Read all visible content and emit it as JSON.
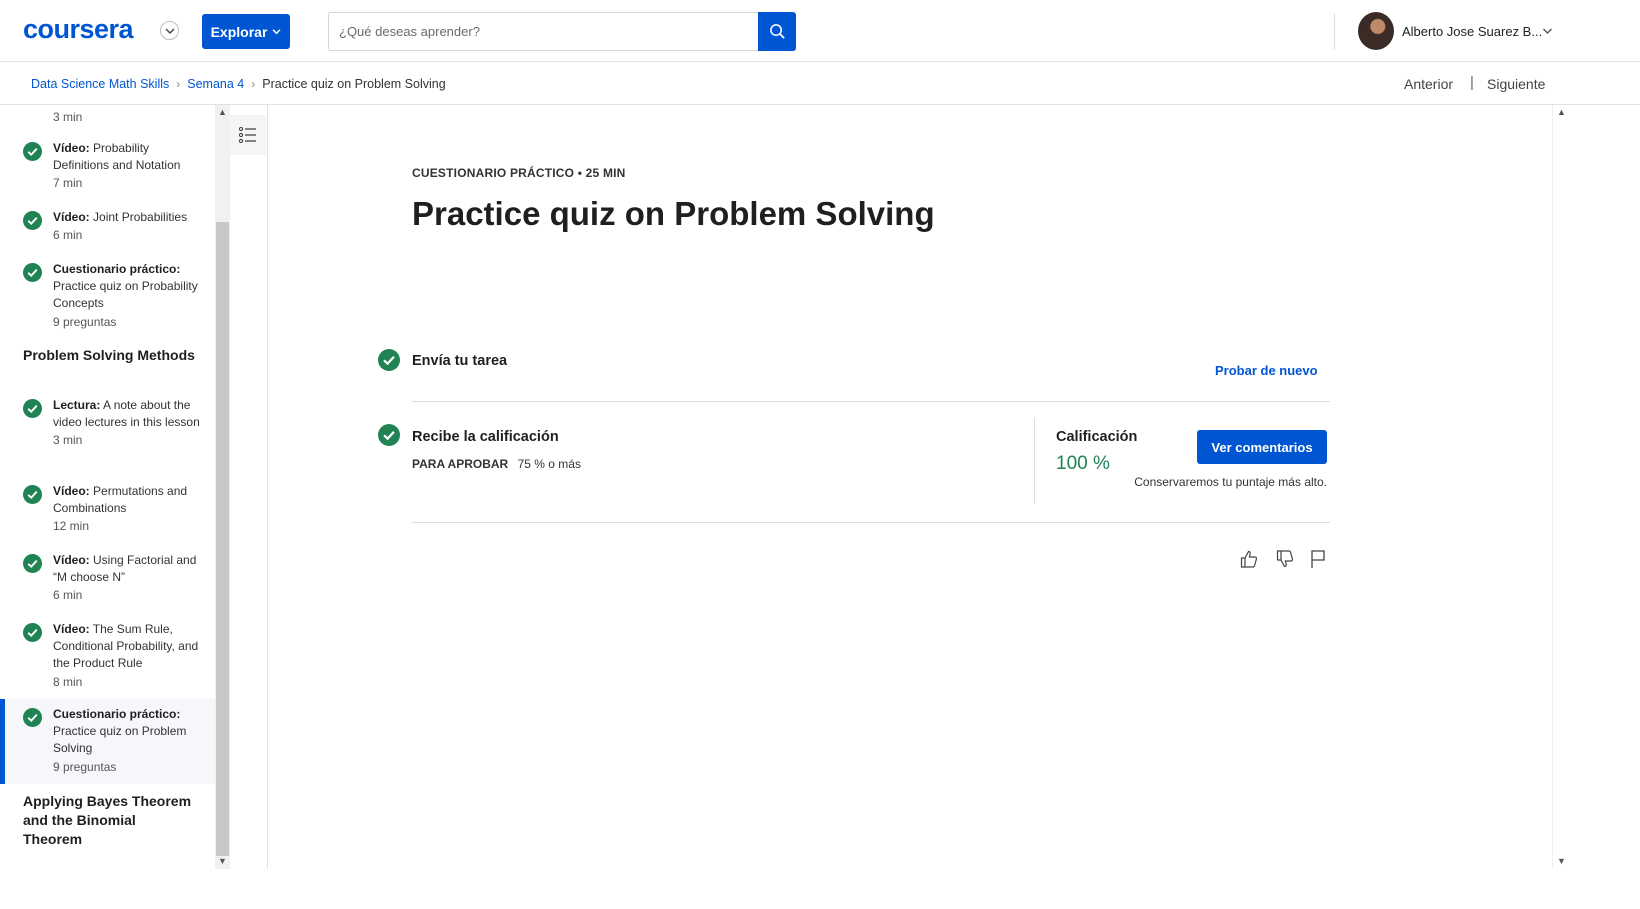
{
  "header": {
    "logo": "coursera",
    "explore_label": "Explorar",
    "search_placeholder": "¿Qué deseas aprender?",
    "user_name": "Alberto Jose Suarez B...",
    "brand_color": "#0056d2"
  },
  "breadcrumb": {
    "items": [
      "Data Science Math Skills",
      "Semana 4",
      "Practice quiz on Problem Solving"
    ],
    "prev_label": "Anterior",
    "separator": "|",
    "next_label": "Siguiente"
  },
  "sidebar": {
    "top_duration": "3 min",
    "items": [
      {
        "type": "Vídeo:",
        "title": "Probability Definitions and Notation",
        "meta": "7 min"
      },
      {
        "type": "Vídeo:",
        "title": "Joint Probabilities",
        "meta": "6 min"
      },
      {
        "type": "Cuestionario práctico:",
        "title": "Practice quiz on Probability Concepts",
        "meta": "9 preguntas"
      },
      {
        "type": "Lectura:",
        "title": "A note about the video lectures in this lesson",
        "meta": "3 min"
      },
      {
        "type": "Vídeo:",
        "title": "Permutations and Combinations",
        "meta": "12 min"
      },
      {
        "type": "Vídeo:",
        "title": "Using Factorial and “M choose N”",
        "meta": "6 min"
      },
      {
        "type": "Vídeo:",
        "title": "The Sum Rule, Conditional Probability, and the Product Rule",
        "meta": "8 min"
      },
      {
        "type": "Cuestionario práctico:",
        "title": "Practice quiz on Problem Solving",
        "meta": "9 preguntas"
      }
    ],
    "sections": [
      "Problem Solving Methods",
      "Applying Bayes Theorem and the Binomial Theorem"
    ]
  },
  "main": {
    "eyebrow": "CUESTIONARIO PRÁCTICO • 25 MIN",
    "title": "Practice quiz on Problem Solving",
    "step1": "Envía tu tarea",
    "retry": "Probar de nuevo",
    "step2": "Recibe la calificación",
    "pass_label": "PARA APROBAR",
    "pass_value": "75 % o más",
    "grade_label": "Calificación",
    "grade_value": "100 %",
    "feedback_button": "Ver comentarios",
    "keep_note": "Conservaremos tu puntaje más alto.",
    "success_color": "#1f8354"
  },
  "icons": [
    "search-icon",
    "check-circle-icon",
    "list-outline-icon",
    "thumbs-up-icon",
    "thumbs-down-icon",
    "flag-icon",
    "chevron-down-icon"
  ]
}
